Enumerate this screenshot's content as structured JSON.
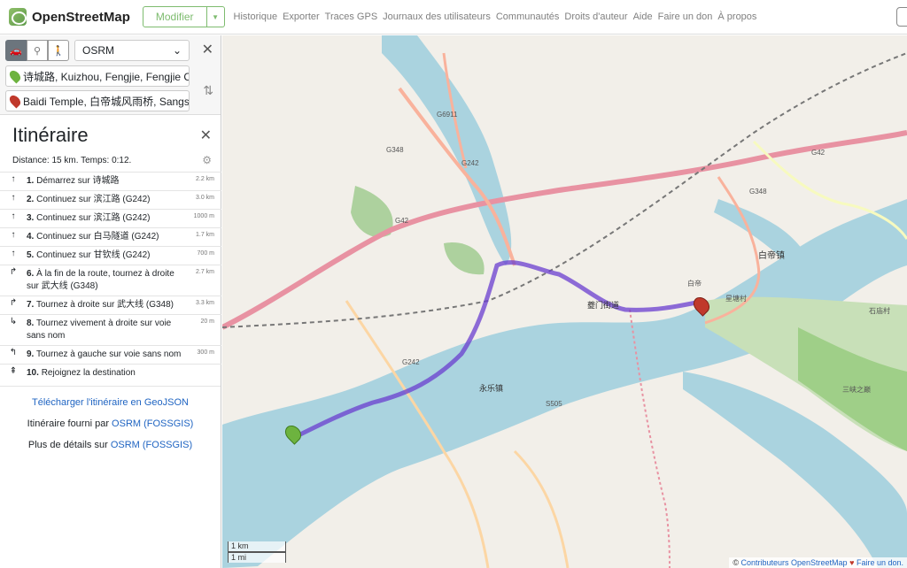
{
  "header": {
    "brand": "OpenStreetMap",
    "edit_label": "Modifier",
    "nav": [
      "Historique",
      "Exporter",
      "Traces GPS",
      "Journaux des utilisateurs",
      "Communautés",
      "Droits d'auteur",
      "Aide",
      "Faire un don",
      "À propos"
    ]
  },
  "route_form": {
    "engine": "OSRM",
    "from": "诗城路, Kuizhou, Fengjie, Fengjie Co",
    "to": "Baidi Temple, 白帝城风雨桥, Sangsh"
  },
  "directions": {
    "title": "Itinéraire",
    "summary": "Distance: 15 km. Temps: 0:12.",
    "steps": [
      {
        "icon": "straight-icon",
        "glyph": "↑",
        "num": "1.",
        "text": "Démarrez sur 诗城路",
        "dist": "2.2 km"
      },
      {
        "icon": "straight-icon",
        "glyph": "↑",
        "num": "2.",
        "text": "Continuez sur 滨江路 (G242)",
        "dist": "3.0 km"
      },
      {
        "icon": "straight-icon",
        "glyph": "↑",
        "num": "3.",
        "text": "Continuez sur 滨江路 (G242)",
        "dist": "1000 m"
      },
      {
        "icon": "straight-icon",
        "glyph": "↑",
        "num": "4.",
        "text": "Continuez sur 白马隧道 (G242)",
        "dist": "1.7 km"
      },
      {
        "icon": "straight-icon",
        "glyph": "↑",
        "num": "5.",
        "text": "Continuez sur 甘钦线 (G242)",
        "dist": "700 m"
      },
      {
        "icon": "turn-right-icon",
        "glyph": "↱",
        "num": "6.",
        "text": "À la fin de la route, tournez à droite sur 武大线 (G348)",
        "dist": "2.7 km"
      },
      {
        "icon": "turn-right-icon",
        "glyph": "↱",
        "num": "7.",
        "text": "Tournez à droite sur 武大线 (G348)",
        "dist": "3.3 km"
      },
      {
        "icon": "sharp-right-icon",
        "glyph": "↳",
        "num": "8.",
        "text": "Tournez vivement à droite sur voie sans nom",
        "dist": "20 m"
      },
      {
        "icon": "turn-left-icon",
        "glyph": "↰",
        "num": "9.",
        "text": "Tournez à gauche sur voie sans nom",
        "dist": "300 m"
      },
      {
        "icon": "destination-icon",
        "glyph": "⇞",
        "num": "10.",
        "text": "Rejoignez la destination",
        "dist": ""
      }
    ],
    "download": "Télécharger l'itinéraire en GeoJSON",
    "provided_by": "Itinéraire fourni par",
    "provider": "OSRM (FOSSGIS)",
    "more_details": "Plus de détails sur",
    "more_provider": "OSRM (FOSSGIS)"
  },
  "map": {
    "labels": {
      "g6911": "G6911",
      "g348_a": "G348",
      "g242_a": "G242",
      "g42_a": "G42",
      "g42_b": "G42",
      "g348_b": "G348",
      "g242_b": "G242",
      "baidi_town": "白帝镇",
      "kuimen": "夔门街道",
      "yongle": "永乐镇",
      "s505": "S505",
      "shimiao": "石庙村",
      "baidi": "白帝",
      "xingtan": "星塘村",
      "sanxia": "三峡之巅"
    },
    "scale_km": "1 km",
    "scale_mi": "1 mi",
    "attribution": "Contributeurs OpenStreetMap",
    "donate": "Faire un don."
  }
}
